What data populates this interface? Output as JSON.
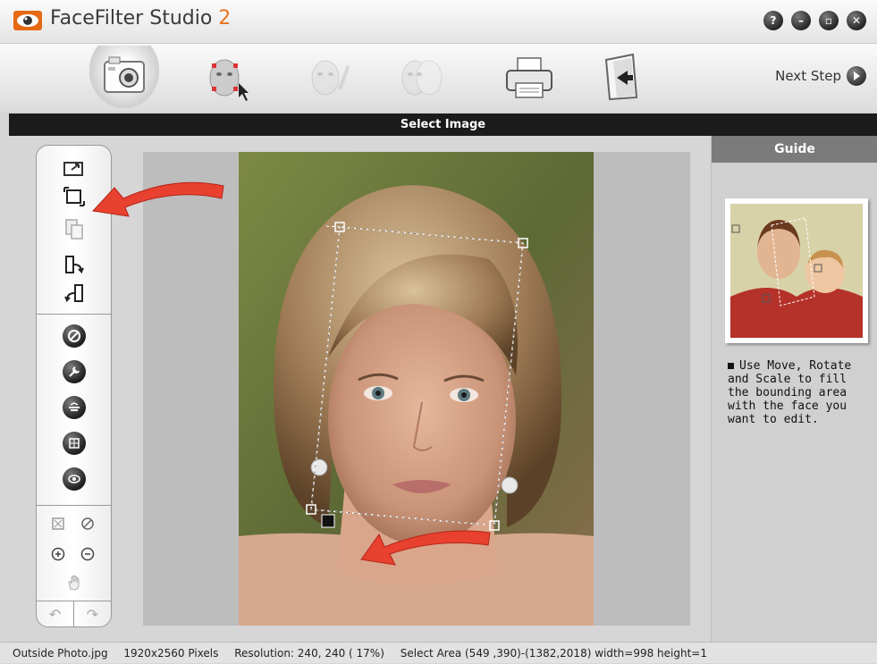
{
  "app": {
    "title": "FaceFilter Studio ",
    "version": "2",
    "brand_color": "#e8731c"
  },
  "window_controls": [
    {
      "name": "help",
      "glyph": "?"
    },
    {
      "name": "minimize",
      "glyph": "–"
    },
    {
      "name": "maximize",
      "glyph": "▫"
    },
    {
      "name": "close",
      "glyph": "✕"
    }
  ],
  "toolbar": {
    "steps": [
      {
        "name": "select-image",
        "icon": "camera-icon",
        "active": true
      },
      {
        "name": "face-detect",
        "icon": "face-marker-icon",
        "active": false
      },
      {
        "name": "face-edit",
        "icon": "face-brush-icon",
        "active": false
      },
      {
        "name": "face-compare",
        "icon": "face-compare-icon",
        "active": false
      },
      {
        "name": "print",
        "icon": "printer-icon",
        "active": false
      },
      {
        "name": "exit",
        "icon": "door-exit-icon",
        "active": false
      }
    ],
    "next_step_label": "Next Step"
  },
  "section": {
    "title": "Select Image"
  },
  "tools": {
    "file_tools": [
      "open-icon",
      "crop-icon",
      "paste-icon",
      "rotate-right-icon",
      "rotate-left-icon"
    ],
    "effect_tools": [
      "contrast-icon",
      "wrench-icon",
      "balance-icon",
      "grid-icon",
      "eye-icon"
    ],
    "view_tools": [
      "fit-icon",
      "no-icon",
      "zoom-in-icon",
      "zoom-out-icon",
      "hand-icon"
    ],
    "undo_glyph": "↶",
    "redo_glyph": "↷"
  },
  "guide": {
    "title": "Guide",
    "text": "Use Move, Rotate and Scale to fill the bounding area with the face you want to edit."
  },
  "status": {
    "filename": "Outside Photo.jpg",
    "pixels": "1920x2560 Pixels",
    "resolution": "Resolution: 240, 240 ( 17%)",
    "select_area": "Select Area (549 ,390)-(1382,2018) width=998  height=1"
  }
}
